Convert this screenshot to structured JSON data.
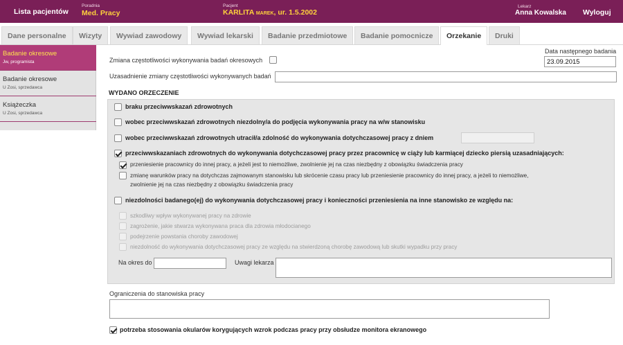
{
  "header": {
    "lista_pacjentow": "Lista pacjentów",
    "poradnia_label": "Poradnia",
    "poradnia_value": "Med. Pracy",
    "pacjent_label": "Pacjent",
    "pacjent_name": "KARLITA",
    "pacjent_second": "MAREK",
    "pacjent_dob": ", ur. 1.5.2002",
    "lekarz_label": "Lekarz",
    "lekarz_value": "Anna Kowalska",
    "wyloguj": "Wyloguj"
  },
  "tabs": [
    {
      "label": "Dane personalne"
    },
    {
      "label": "Wizyty"
    },
    {
      "label": "Wywiad zawodowy"
    },
    {
      "label": "Wywiad lekarski"
    },
    {
      "label": "Badanie przedmiotowe"
    },
    {
      "label": "Badanie pomocnicze"
    },
    {
      "label": "Orzekanie"
    },
    {
      "label": "Druki"
    }
  ],
  "active_tab": "Orzekanie",
  "sidebar": {
    "items": [
      {
        "title": "Badanie okresowe",
        "subtitle": "Jw, programista"
      },
      {
        "title": "Badanie okresowe",
        "subtitle": "U Zosi, sprzedawca"
      },
      {
        "title": "Książeczka",
        "subtitle": "U Zosi, sprzedawca"
      }
    ]
  },
  "form": {
    "zmiana_label": "Zmiana częstotliwości wykonywania badań okresowych",
    "data_nastepnego_label": "Data następnego badania",
    "data_nastepnego_value": "23.09.2015",
    "uzasadnienie_label": "Uzasadnienie zmiany częstotliwości wykonywanych badań",
    "uzasadnienie_value": "",
    "wydano_title": "WYDANO ORZECZENIE",
    "opt1": "braku przeciwwskazań zdrowotnych",
    "opt2": "wobec przeciwwskazań zdrowotnych niezdolny/a do podjęcia wykonywania pracy na w/w stanowisku",
    "opt3": "wobec przeciwwskazań zdrowotnych utracił/a zdolność do wykonywania dotychczasowej pracy z dniem",
    "opt3_date": "",
    "opt4": "przeciwwskazaniach zdrowotnych do wykonywania dotychczasowej pracy przez pracownicę w ciąży lub karmiącej dziecko piersią uzasadniających:",
    "opt4_sub1": "przeniesienie pracownicy do innej pracy, a jeżeli jest to niemożliwe, zwolnienie jej na czas niezbędny z obowiązku świadczenia pracy",
    "opt4_sub2_line1": "zmianę warunków pracy na dotychczas zajmowanym stanowisku lub skrócenie czasu pracy lub przeniesienie pracownicy do innej pracy, a jeżeli to niemożliwe,",
    "opt4_sub2_line2": "zwolnienie jej na czas niezbędny z obowiązku świadczenia pracy",
    "opt5": "niezdolności badanego(ej) do wykonywania dotychczasowej pracy i konieczności przeniesienia na inne stanowisko ze względu na:",
    "opt5_sub1": "szkodliwy wpływ wykonywanej pracy na zdrowie",
    "opt5_sub2": "zagrożenie, jakie stwarza wykonywana praca dla zdrowia młodocianego",
    "opt5_sub3": "podejrzenie powstania choroby zawodowej",
    "opt5_sub4": "niezdolność do wykonywania dotychczasowej pracy ze względu na stwierdzoną chorobę zawodową lub skutki wypadku przy pracy",
    "na_okres_label": "Na okres do",
    "na_okres_value": "",
    "uwagi_label": "Uwagi lekarza",
    "uwagi_value": "",
    "ograniczenia_label": "Ograniczenia do stanowiska pracy",
    "ograniczenia_value": "",
    "okulary_label": "potrzeba stosowania okularów korygujących wzrok podczas pracy przy obsłudze monitora ekranowego"
  },
  "checkbox_state": {
    "zmiana": false,
    "opt1": false,
    "opt2": false,
    "opt3": false,
    "opt4": true,
    "opt4_sub1": true,
    "opt4_sub2": false,
    "opt5": false,
    "okulary": true
  },
  "colors": {
    "header_bg": "#7a1f57",
    "header_accent": "#ffd23c",
    "sidebar_active": "#b03c78"
  }
}
